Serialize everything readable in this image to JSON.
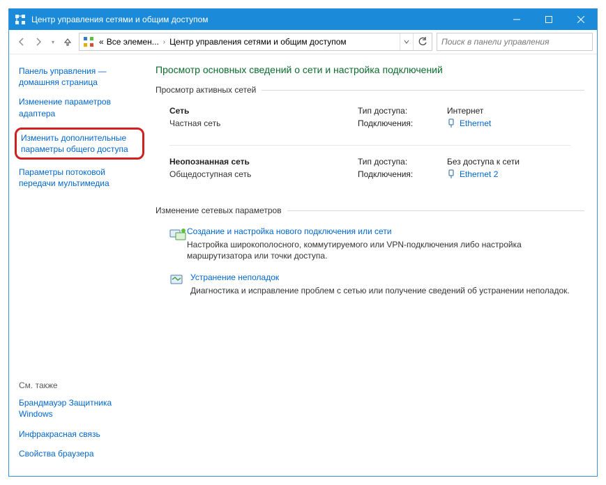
{
  "window": {
    "title": "Центр управления сетями и общим доступом"
  },
  "breadcrumb": {
    "all_elements": "Все элемен...",
    "current": "Центр управления сетями и общим доступом"
  },
  "search": {
    "placeholder": "Поиск в панели управления"
  },
  "sidebar": {
    "items": [
      "Панель управления — домашняя страница",
      "Изменение параметров адаптера",
      "Изменить дополнительные параметры общего доступа",
      "Параметры потоковой передачи мультимедиа"
    ],
    "see_also_heading": "См. также",
    "see_also": [
      "Брандмауэр Защитника Windows",
      "Инфракрасная связь",
      "Свойства браузера"
    ]
  },
  "main": {
    "title": "Просмотр основных сведений о сети и настройка подключений",
    "active_networks_label": "Просмотр активных сетей",
    "net1": {
      "name": "Сеть",
      "type": "Частная сеть",
      "access_label": "Тип доступа:",
      "access_value": "Интернет",
      "conn_label": "Подключения:",
      "conn_value": "Ethernet"
    },
    "net2": {
      "name": "Неопознанная сеть",
      "type": "Общедоступная сеть",
      "access_label": "Тип доступа:",
      "access_value": "Без доступа к сети",
      "conn_label": "Подключения:",
      "conn_value": "Ethernet 2"
    },
    "change_settings_label": "Изменение сетевых параметров",
    "action1": {
      "title": "Создание и настройка нового подключения или сети",
      "desc": "Настройка широкополосного, коммутируемого или VPN-подключения либо настройка маршрутизатора или точки доступа."
    },
    "action2": {
      "title": "Устранение неполадок",
      "desc": "Диагностика и исправление проблем с сетью или получение сведений об устранении неполадок."
    }
  }
}
